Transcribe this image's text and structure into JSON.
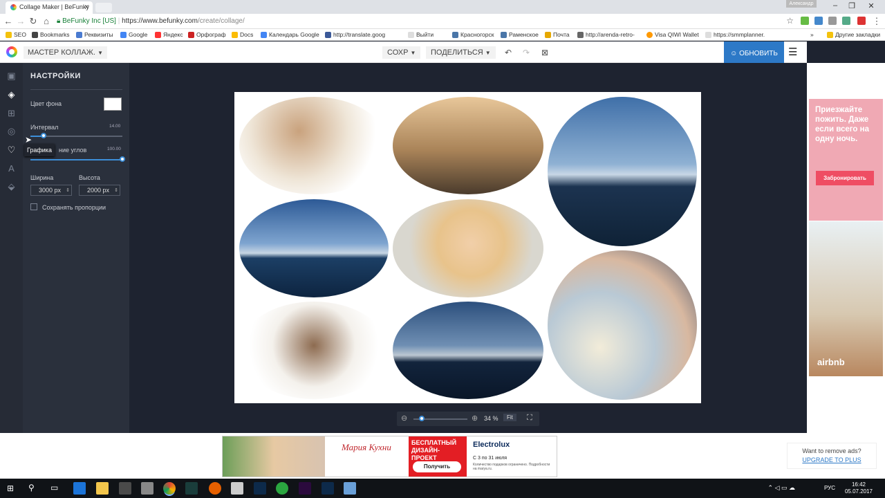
{
  "browser": {
    "tab_title": "Collage Maker | BeFunky",
    "user_name": "Александр",
    "secure_label": "BeFunky Inc [US]",
    "url_host": "https://www.befunky.com",
    "url_path": "/create/collage/",
    "bookmarks": [
      "SEO",
      "Bookmarks",
      "Реквизиты",
      "Google",
      "Яндекс",
      "Орфограф",
      "Docs",
      "Календарь Google",
      "http://translate.goog",
      "Выйти",
      "Красногорск",
      "Раменское",
      "Почта",
      "http://arenda-retro-",
      "Visa QIWI Wallet",
      "https://smmplanner."
    ],
    "other_bookmarks": "Другие закладки"
  },
  "app": {
    "mode_label": "МАСТЕР КОЛЛАЖ.",
    "save_label": "СОХР",
    "share_label": "ПОДЕЛИТЬСЯ",
    "upgrade_label": "ОБНОВИТЬ",
    "accent": "#2d79c7"
  },
  "panel": {
    "title": "НАСТРОЙКИ",
    "bg_color_label": "Цвет фона",
    "spacing_label": "Интервал",
    "spacing_value": "14.00",
    "spacing_level": 0.14,
    "corner_label": "ние углов",
    "corner_value": "100.00",
    "corner_level": 1.0,
    "width_label": "Ширина",
    "height_label": "Высота",
    "width_value": "3000 px",
    "height_value": "2000 px",
    "keep_ratio_label": "Сохранять пропорции",
    "tooltip": "Графика"
  },
  "zoom": {
    "value": "34 %",
    "fit_label": "Fit",
    "level": 0.15
  },
  "ads": {
    "side_text": "Приезжайте пожить. Даже если всего на одну ночь.",
    "side_button": "Забронировать",
    "side_brand": "airbnb",
    "banner_brand": "Мария Кухни",
    "banner_promo": "БЕСПЛАТНЫЙ ДИЗАЙН-ПРОЕКТ",
    "banner_cta": "Получить",
    "banner_electrolux": "Electrolux",
    "banner_dates": "С 3 по 31 июля",
    "banner_note": "Количество подарков ограничено. Подробности на marya.ru.",
    "remove_ads": "Want to remove ads?",
    "upgrade_plus": "UPGRADE TO PLUS"
  },
  "taskbar": {
    "lang": "РУС",
    "time": "16:42",
    "date": "05.07.2017"
  }
}
